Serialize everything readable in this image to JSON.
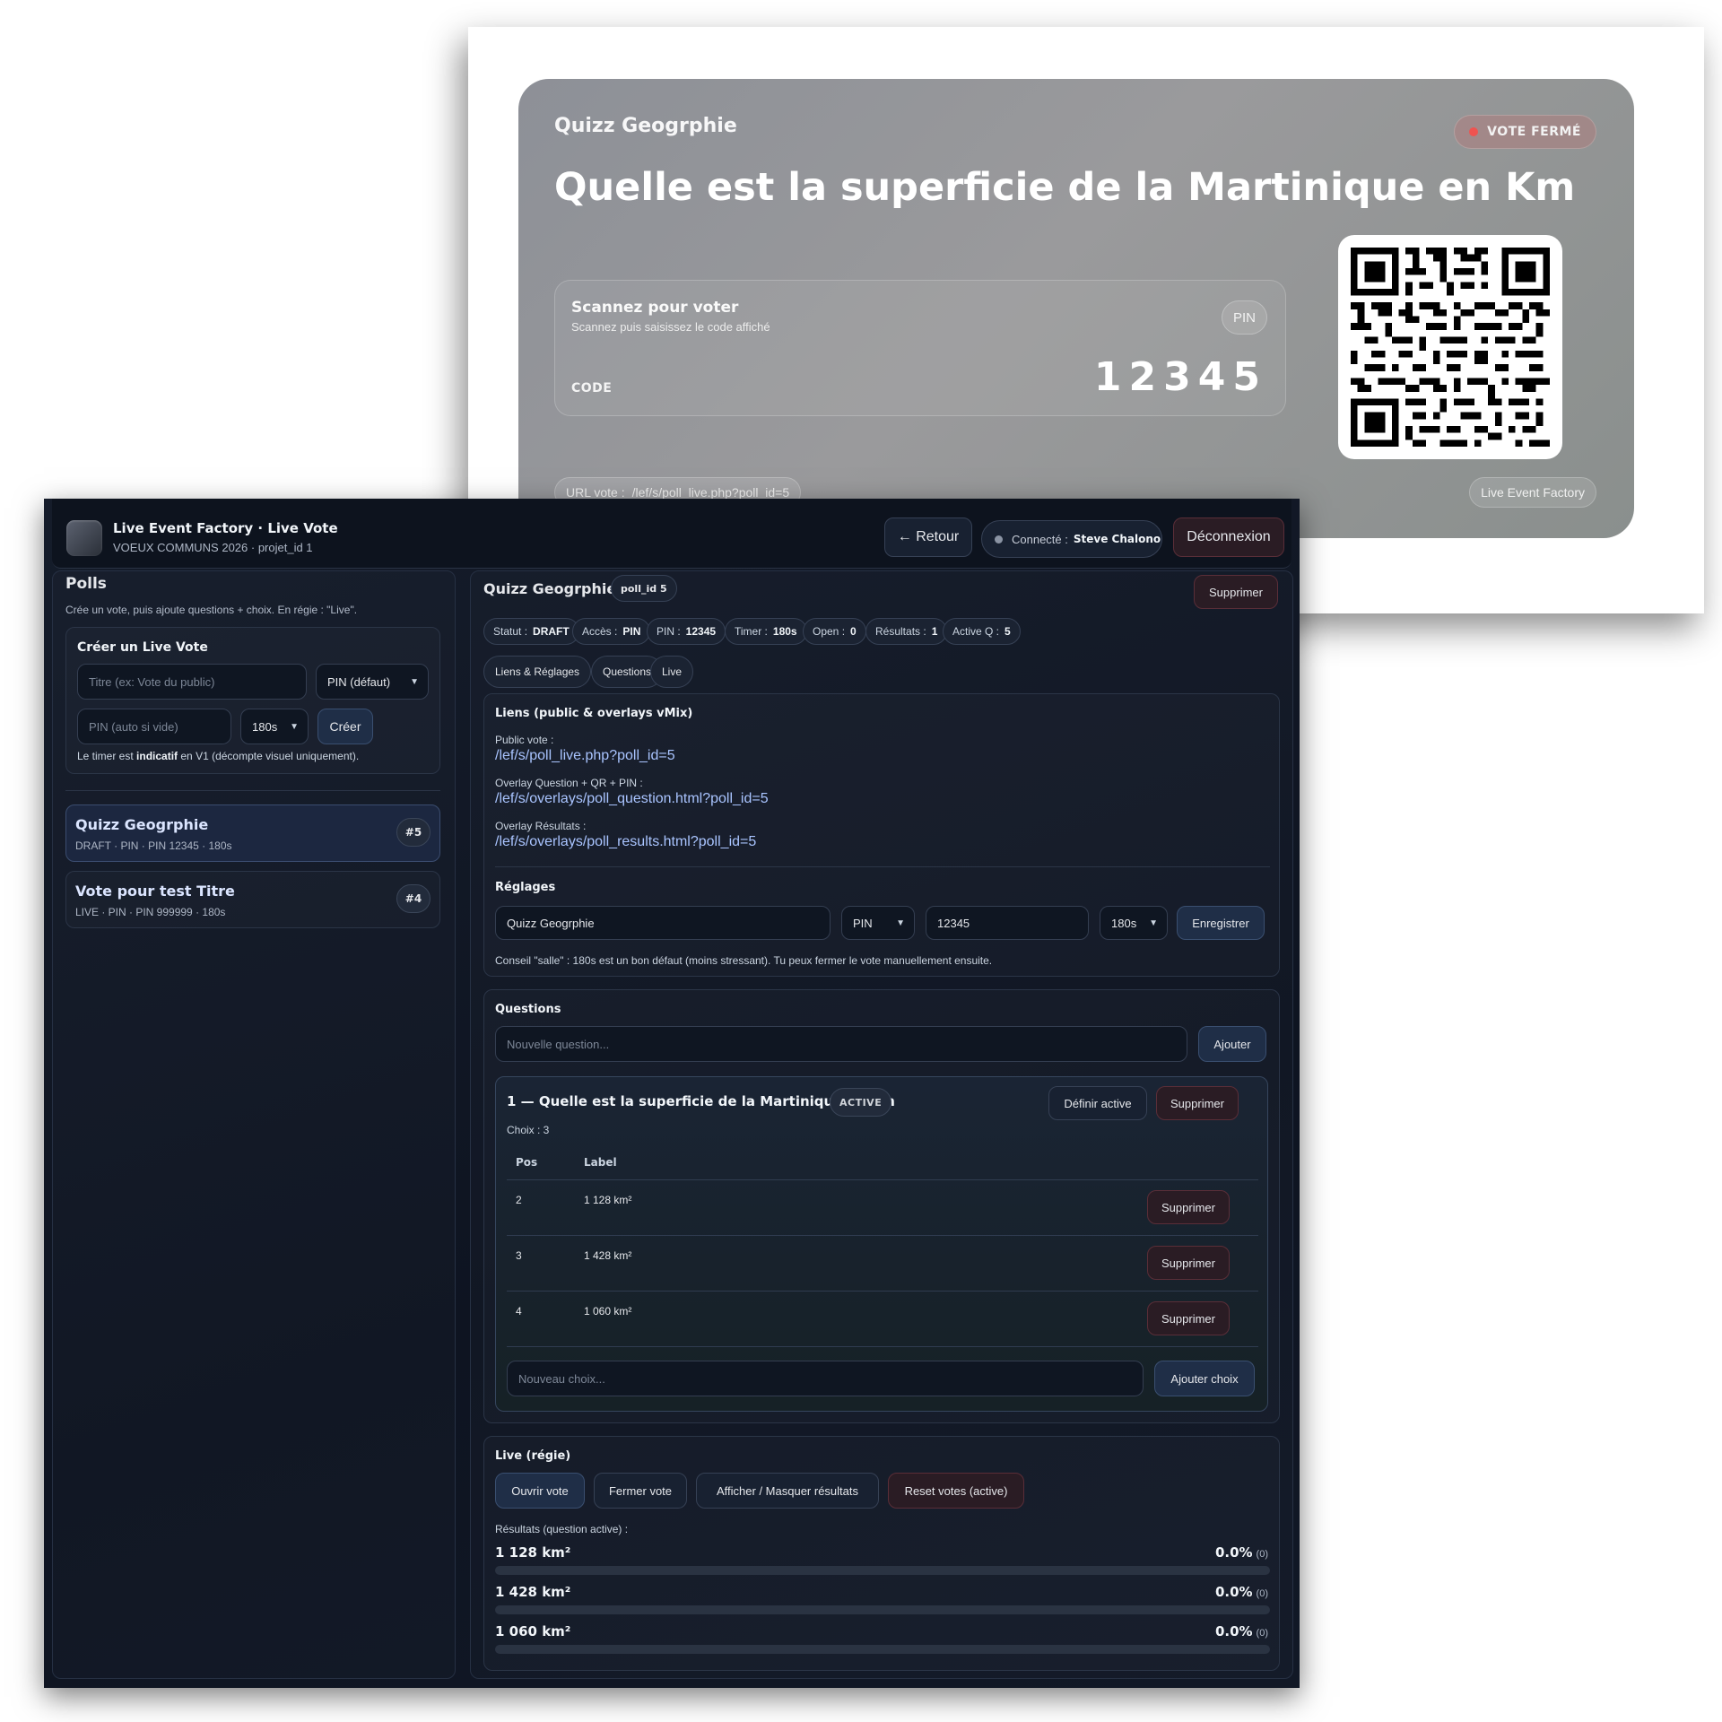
{
  "overlay": {
    "poll_title": "Quizz Geogrphie",
    "status_badge": "VOTE FERMÉ",
    "question": "Quelle est la superficie de la Martinique en Km",
    "scan_title": "Scannez pour voter",
    "scan_sub": "Scannez puis saisissez le code affiché",
    "code_label": "CODE",
    "pin_label": "PIN",
    "pin_value": "12345",
    "url_label": "URL vote :",
    "url_value": "/lef/s/poll_live.php?poll_id=5",
    "brand": "Live Event Factory"
  },
  "header": {
    "title": "Live Event Factory · Live Vote",
    "subtitle": "VOEUX COMMUNS 2026 · projet_id 1",
    "back_label": "← Retour",
    "connected_label": "Connecté :",
    "connected_user": "Steve Chalono",
    "logout_label": "Déconnexion"
  },
  "left": {
    "heading": "Polls",
    "description": "Crée un vote, puis ajoute questions + choix. En régie : \"Live\".",
    "create": {
      "title": "Créer un Live Vote",
      "title_placeholder": "Titre (ex: Vote du public)",
      "access_select": "PIN (défaut)",
      "pin_placeholder": "PIN (auto si vide)",
      "timer_select": "180s",
      "create_label": "Créer",
      "note_pre": "Le timer est ",
      "note_bold": "indicatif",
      "note_post": " en V1 (décompte visuel uniquement)."
    },
    "polls": [
      {
        "title": "Quizz Geogrphie",
        "meta": "DRAFT · PIN · PIN 12345 · 180s",
        "id": "#5"
      },
      {
        "title": "Vote pour test Titre",
        "meta": "LIVE · PIN · PIN 999999 · 180s",
        "id": "#4"
      }
    ]
  },
  "right": {
    "title": "Quizz Geogrphie",
    "poll_id": "poll_id 5",
    "delete_label": "Supprimer",
    "tags": [
      {
        "k": "Statut :",
        "v": "DRAFT"
      },
      {
        "k": "Accès :",
        "v": "PIN"
      },
      {
        "k": "PIN :",
        "v": "12345"
      },
      {
        "k": "Timer :",
        "v": "180s"
      },
      {
        "k": "Open :",
        "v": "0"
      },
      {
        "k": "Résultats :",
        "v": "1"
      },
      {
        "k": "Active Q :",
        "v": "5"
      }
    ],
    "tabs": [
      "Liens & Réglages",
      "Questions",
      "Live"
    ],
    "links": {
      "heading": "Liens (public & overlays vMix)",
      "public_label": "Public vote :",
      "public_url": "/lef/s/poll_live.php?poll_id=5",
      "question_label": "Overlay Question + QR + PIN :",
      "question_url": "/lef/s/overlays/poll_question.html?poll_id=5",
      "results_label": "Overlay Résultats :",
      "results_url": "/lef/s/overlays/poll_results.html?poll_id=5"
    },
    "settings": {
      "heading": "Réglages",
      "title_value": "Quizz Geogrphie",
      "access": "PIN",
      "pin": "12345",
      "timer": "180s",
      "save_label": "Enregistrer",
      "hint": "Conseil \"salle\" : 180s est un bon défaut (moins stressant). Tu peux fermer le vote manuellement ensuite."
    },
    "questions": {
      "heading": "Questions",
      "new_placeholder": "Nouvelle question...",
      "add_label": "Ajouter",
      "item": {
        "title": "1 — Quelle est la superficie de la Martinique en Km",
        "badge": "ACTIVE",
        "set_active_label": "Définir active",
        "delete_label": "Supprimer",
        "count": "Choix : 3",
        "col_pos": "Pos",
        "col_label": "Label",
        "choices": [
          {
            "pos": "2",
            "label": "1 128 km²",
            "delete": "Supprimer"
          },
          {
            "pos": "3",
            "label": "1 428 km²",
            "delete": "Supprimer"
          },
          {
            "pos": "4",
            "label": "1 060 km²",
            "delete": "Supprimer"
          }
        ],
        "new_choice_placeholder": "Nouveau choix...",
        "add_choice_label": "Ajouter choix"
      }
    },
    "live": {
      "heading": "Live (régie)",
      "open_label": "Ouvrir vote",
      "close_label": "Fermer vote",
      "toggle_label": "Afficher / Masquer résultats",
      "reset_label": "Reset votes (active)",
      "results_label": "Résultats (question active) :",
      "results": [
        {
          "label": "1 128 km²",
          "pct": "0.0%",
          "count": "(0)",
          "fraction": 0
        },
        {
          "label": "1 428 km²",
          "pct": "0.0%",
          "count": "(0)",
          "fraction": 0
        },
        {
          "label": "1 060 km²",
          "pct": "0.0%",
          "count": "(0)",
          "fraction": 0
        }
      ]
    }
  },
  "colors": {
    "accent": "#a9c4ff",
    "danger": "#ef5350",
    "bar_fill": "#60a5fa"
  }
}
